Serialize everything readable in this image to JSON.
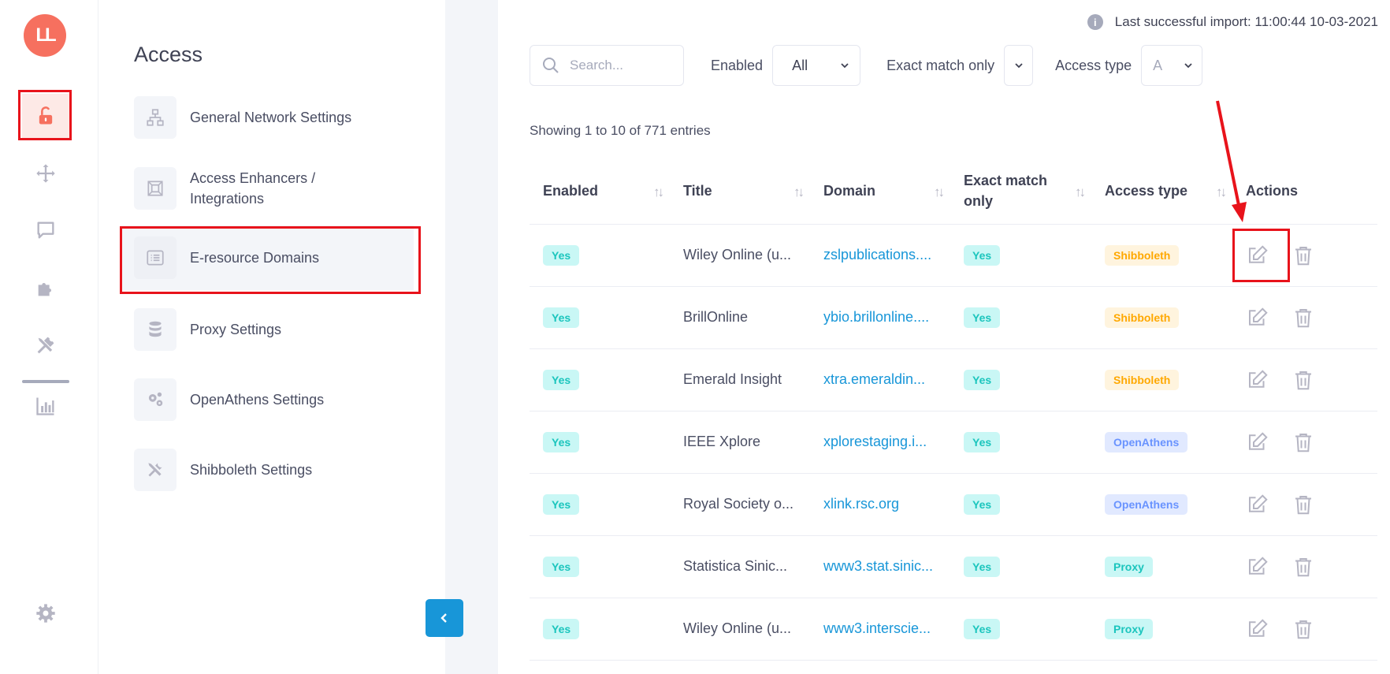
{
  "logo": {
    "text": "LL",
    "color": "#f6705f"
  },
  "rail": {
    "items": [
      {
        "name": "lock-open-icon",
        "active": true
      },
      {
        "name": "move-icon",
        "active": false
      },
      {
        "name": "chat-icon",
        "active": false
      },
      {
        "name": "puzzle-icon",
        "active": false
      },
      {
        "name": "tools-icon",
        "active": false
      },
      {
        "name": "chart-icon",
        "active": false
      },
      {
        "name": "gear-icon",
        "active": false
      }
    ]
  },
  "menu": {
    "title": "Access",
    "items": [
      {
        "label": "General Network Settings",
        "icon": "network-icon"
      },
      {
        "label": "Access Enhancers / Integrations",
        "icon": "integration-icon"
      },
      {
        "label": "E-resource Domains",
        "icon": "list-icon",
        "active": true
      },
      {
        "label": "Proxy Settings",
        "icon": "database-icon"
      },
      {
        "label": "OpenAthens Settings",
        "icon": "gears-icon"
      },
      {
        "label": "Shibboleth Settings",
        "icon": "tools-icon"
      }
    ]
  },
  "header": {
    "import_info": "Last successful import: 11:00:44 10-03-2021"
  },
  "filters": {
    "search_placeholder": "Search...",
    "enabled_label": "Enabled",
    "enabled_value": "All",
    "exact_label": "Exact match only",
    "exact_value": "",
    "access_label": "Access type",
    "access_value": "A"
  },
  "entries_text": "Showing 1 to 10 of 771 entries",
  "table": {
    "headers": {
      "enabled": "Enabled",
      "title": "Title",
      "domain": "Domain",
      "exact": "Exact match only",
      "access": "Access type",
      "actions": "Actions"
    },
    "rows": [
      {
        "enabled": "Yes",
        "title": "Wiley Online (u...",
        "domain": "zslpublications....",
        "exact": "Yes",
        "access": "Shibboleth"
      },
      {
        "enabled": "Yes",
        "title": "BrillOnline",
        "domain": "ybio.brillonline....",
        "exact": "Yes",
        "access": "Shibboleth"
      },
      {
        "enabled": "Yes",
        "title": "Emerald Insight",
        "domain": "xtra.emeraldin...",
        "exact": "Yes",
        "access": "Shibboleth"
      },
      {
        "enabled": "Yes",
        "title": "IEEE Xplore",
        "domain": "xplorestaging.i...",
        "exact": "Yes",
        "access": "OpenAthens"
      },
      {
        "enabled": "Yes",
        "title": "Royal Society o...",
        "domain": "xlink.rsc.org",
        "exact": "Yes",
        "access": "OpenAthens"
      },
      {
        "enabled": "Yes",
        "title": "Statistica Sinic...",
        "domain": "www3.stat.sinic...",
        "exact": "Yes",
        "access": "Proxy"
      },
      {
        "enabled": "Yes",
        "title": "Wiley Online (u...",
        "domain": "www3.interscie...",
        "exact": "Yes",
        "access": "Proxy"
      }
    ]
  },
  "colors": {
    "accent": "#f6705f",
    "link": "#1896d8",
    "annotation": "#e8131b"
  }
}
